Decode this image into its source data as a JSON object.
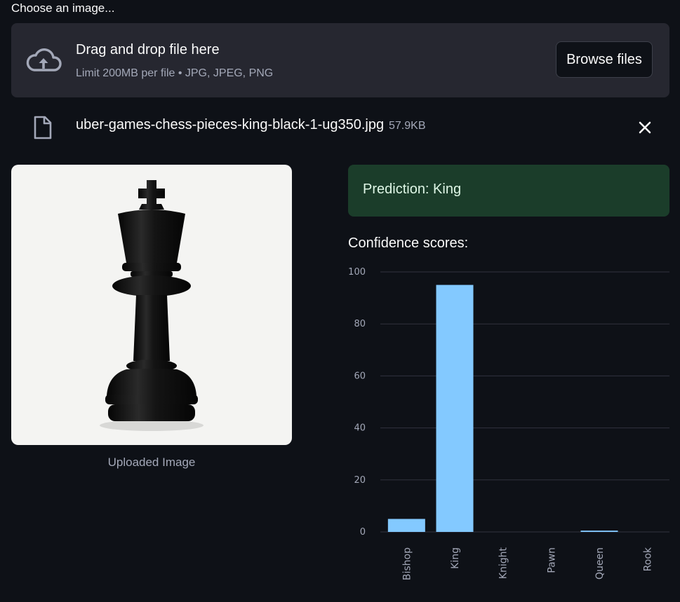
{
  "uploader": {
    "label": "Choose an image...",
    "drop_title": "Drag and drop file here",
    "drop_subtitle": "Limit 200MB per file • JPG, JPEG, PNG",
    "browse_label": "Browse files"
  },
  "file": {
    "name": "uber-games-chess-pieces-king-black-1-ug350.jpg",
    "size": "57.9KB"
  },
  "image": {
    "caption": "Uploaded Image"
  },
  "result": {
    "prediction": "Prediction: King",
    "confidence_label": "Confidence scores:"
  },
  "colors": {
    "bar": "#83c9ff",
    "prediction_bg": "#1b3d2a",
    "background": "#0e1117"
  },
  "chart_data": {
    "type": "bar",
    "categories": [
      "Bishop",
      "King",
      "Knight",
      "Pawn",
      "Queen",
      "Rook"
    ],
    "values": [
      5,
      95,
      0,
      0,
      0.5,
      0
    ],
    "ylim": [
      0,
      100
    ],
    "yticks": [
      0,
      20,
      40,
      60,
      80,
      100
    ],
    "grid": true
  }
}
